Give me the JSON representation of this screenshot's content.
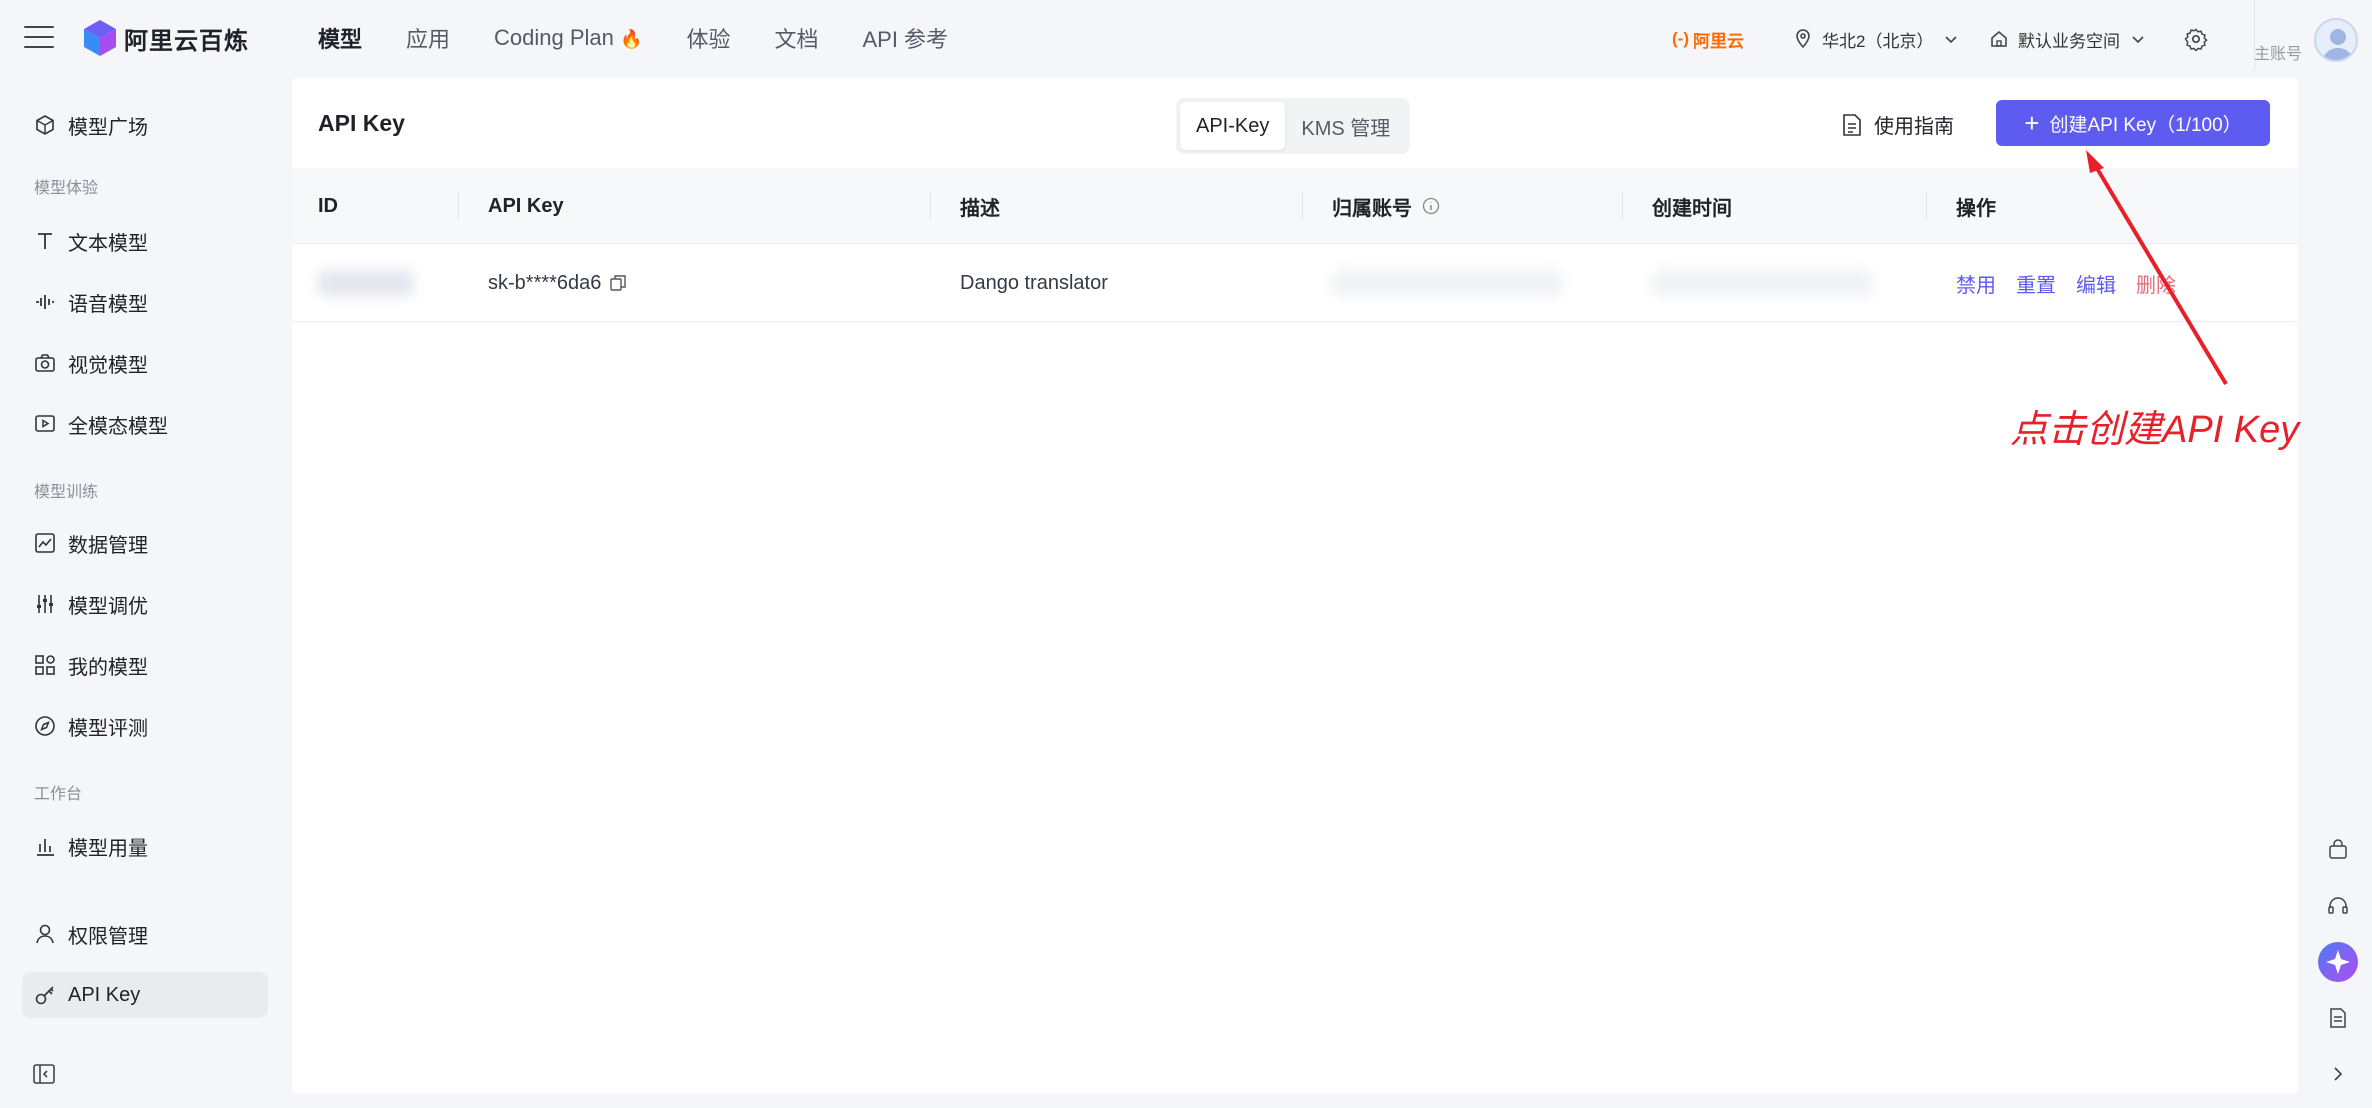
{
  "brand": {
    "name": "阿里云百炼"
  },
  "topnav": [
    {
      "label": "模型",
      "active": true
    },
    {
      "label": "应用"
    },
    {
      "label": "Coding Plan"
    },
    {
      "label": "体验"
    },
    {
      "label": "文档"
    },
    {
      "label": "API 参考"
    }
  ],
  "header": {
    "aliyun_label": "阿里云",
    "region": "华北2（北京）",
    "workspace": "默认业务空间",
    "account_label": "主账号"
  },
  "sidebar": {
    "top_item": "模型广场",
    "groups": [
      "模型体验",
      "模型训练",
      "工作台"
    ],
    "items": [
      "文本模型",
      "语音模型",
      "视觉模型",
      "全模态模型",
      "数据管理",
      "模型调优",
      "我的模型",
      "模型评测",
      "模型用量",
      "权限管理",
      "API Key"
    ],
    "active": "API Key"
  },
  "page": {
    "title": "API Key",
    "tabs": [
      "API-Key",
      "KMS 管理"
    ],
    "active_tab": "API-Key",
    "guide_label": "使用指南",
    "create_label": "创建API Key（1/100）"
  },
  "table": {
    "columns": [
      "ID",
      "API Key",
      "描述",
      "归属账号",
      "创建时间",
      "操作"
    ],
    "rows": [
      {
        "api_key": "sk-b****6da6",
        "description": "Dango translator",
        "actions": [
          "禁用",
          "重置",
          "编辑",
          "删除"
        ]
      }
    ]
  },
  "annotation": {
    "text": "点击创建API Key",
    "color": "#e8202a"
  },
  "colors": {
    "primary": "#5d5bf0",
    "danger": "#e66b78",
    "brand_orange": "#ff6a00"
  }
}
